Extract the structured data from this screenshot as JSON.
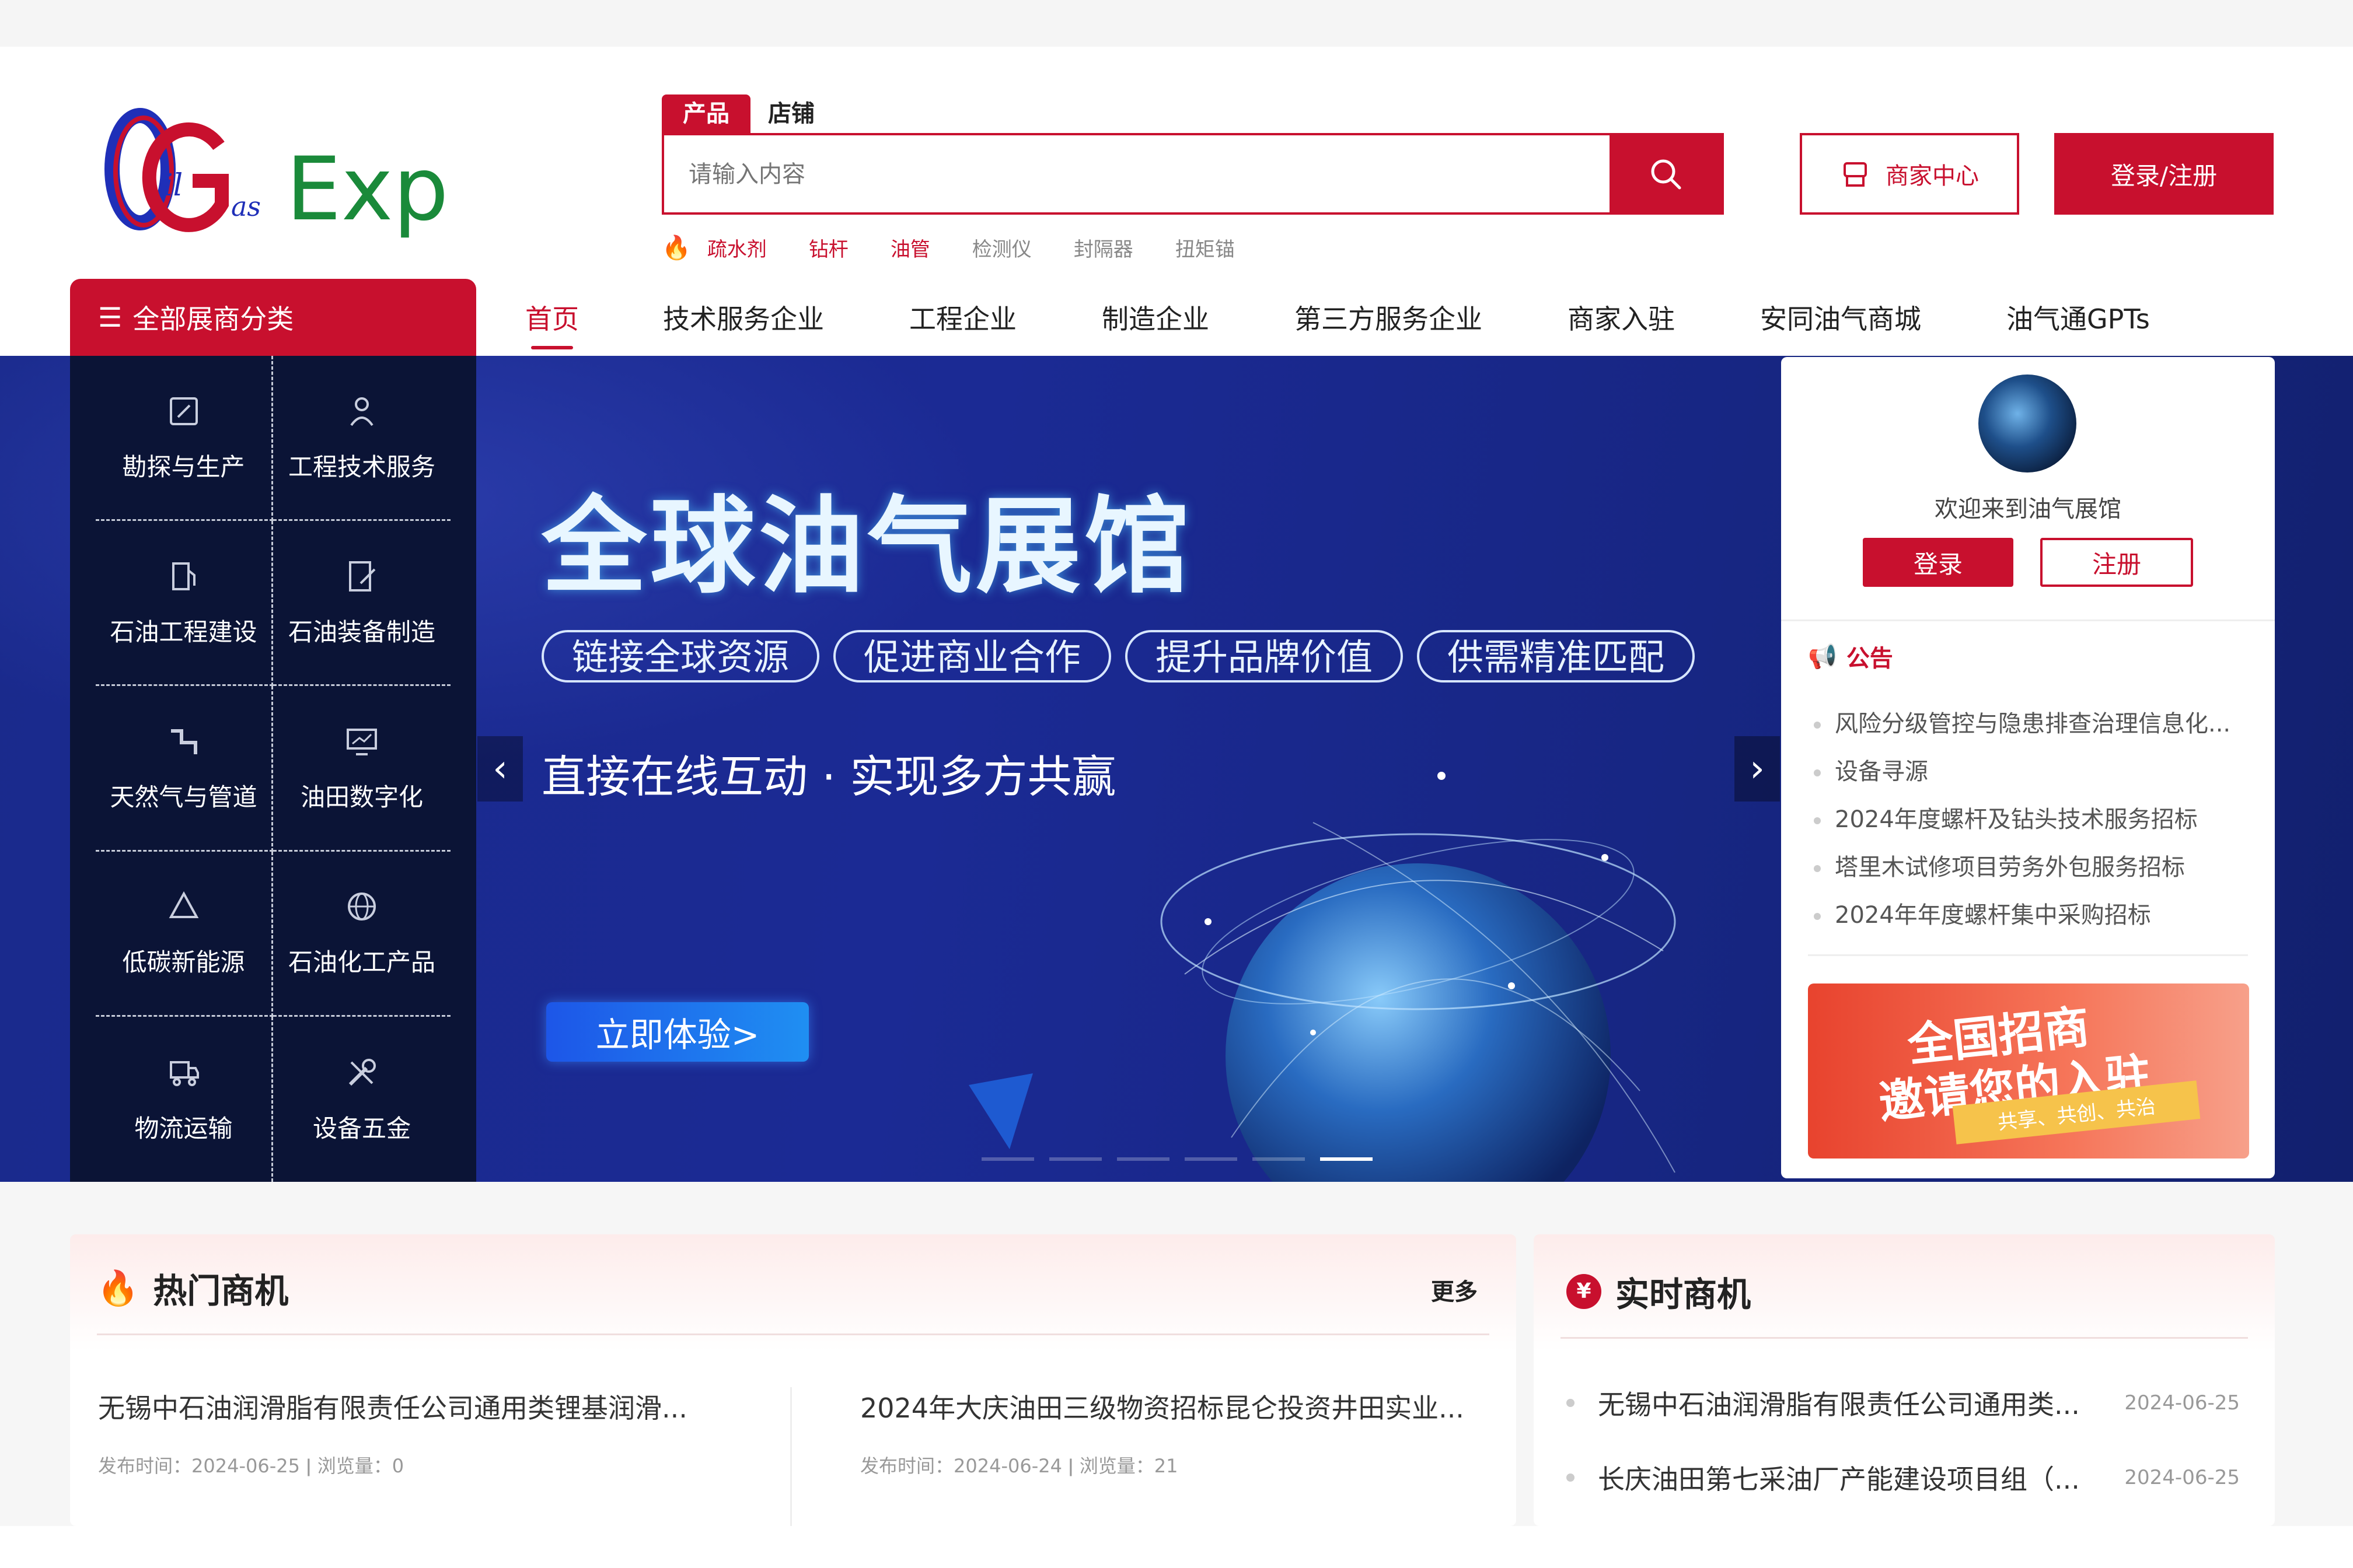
{
  "brand": {
    "logo_text_1": "il",
    "logo_text_2": "as",
    "logo_text_3": "Expo"
  },
  "search": {
    "tabs": [
      "产品",
      "店铺"
    ],
    "placeholder": "请输入内容",
    "hot_keywords": [
      {
        "label": "疏水剂",
        "highlight": true
      },
      {
        "label": "钻杆",
        "highlight": true
      },
      {
        "label": "油管",
        "highlight": true
      },
      {
        "label": "检测仪",
        "highlight": false
      },
      {
        "label": "封隔器",
        "highlight": false
      },
      {
        "label": "扭矩锚",
        "highlight": false
      }
    ]
  },
  "header": {
    "merchant_center": "商家中心",
    "login_register": "登录/注册"
  },
  "nav": {
    "all_categories": "全部展商分类",
    "items": [
      "首页",
      "技术服务企业",
      "工程企业",
      "制造企业",
      "第三方服务企业",
      "商家入驻",
      "安同油气商城",
      "油气通GPTs"
    ]
  },
  "categories": [
    {
      "label": "勘探与生产",
      "icon": "edit-icon"
    },
    {
      "label": "工程技术服务",
      "icon": "worker-icon"
    },
    {
      "label": "石油工程建设",
      "icon": "fuel-pump-icon"
    },
    {
      "label": "石油装备制造",
      "icon": "document-edit-icon"
    },
    {
      "label": "天然气与管道",
      "icon": "pipe-icon"
    },
    {
      "label": "油田数字化",
      "icon": "monitor-chart-icon"
    },
    {
      "label": "低碳新能源",
      "icon": "recycle-icon"
    },
    {
      "label": "石油化工产品",
      "icon": "globe-icon"
    },
    {
      "label": "物流运输",
      "icon": "truck-icon"
    },
    {
      "label": "设备五金",
      "icon": "tools-icon"
    }
  ],
  "banner": {
    "title": "全球油气展馆",
    "pills": [
      "链接全球资源",
      "促进商业合作",
      "提升品牌价值",
      "供需精准匹配"
    ],
    "slogan": "直接在线互动 · 实现多方共赢",
    "cta": "立即体验>",
    "slide_count": 6,
    "active_slide": 6
  },
  "user_card": {
    "welcome": "欢迎来到油气展馆",
    "login": "登录",
    "register": "注册",
    "notice_title": "公告",
    "notices": [
      "风险分级管控与隐患排查治理信息化...",
      "设备寻源",
      "2024年度螺杆及钻头技术服务招标",
      "塔里木试修项目劳务外包服务招标",
      "2024年年度螺杆集中采购招标"
    ],
    "promo": {
      "line1": "全国招商",
      "line2": "邀请您的入驻",
      "ribbon": "共享、共创、共治"
    }
  },
  "hot_deals": {
    "title": "热门商机",
    "more": "更多",
    "items": [
      {
        "title": "无锡中石油润滑脂有限责任公司通用类锂基润滑...",
        "meta": "发布时间：2024-06-25  ǀ  浏览量：0"
      },
      {
        "title": "2024年大庆油田三级物资招标昆仑投资井田实业...",
        "meta": "发布时间：2024-06-24  ǀ  浏览量：21"
      }
    ]
  },
  "live_deals": {
    "title": "实时商机",
    "items": [
      {
        "title": "无锡中石油润滑脂有限责任公司通用类...",
        "date": "2024-06-25"
      },
      {
        "title": "长庆油田第七采油厂产能建设项目组（...",
        "date": "2024-06-25"
      }
    ]
  },
  "colors": {
    "brand_red": "#c8102e",
    "banner_blue": "#1b2a94",
    "panel_dark": "#0b1436",
    "logo_green": "#1a8a3a",
    "logo_blue": "#1f2fb8"
  }
}
